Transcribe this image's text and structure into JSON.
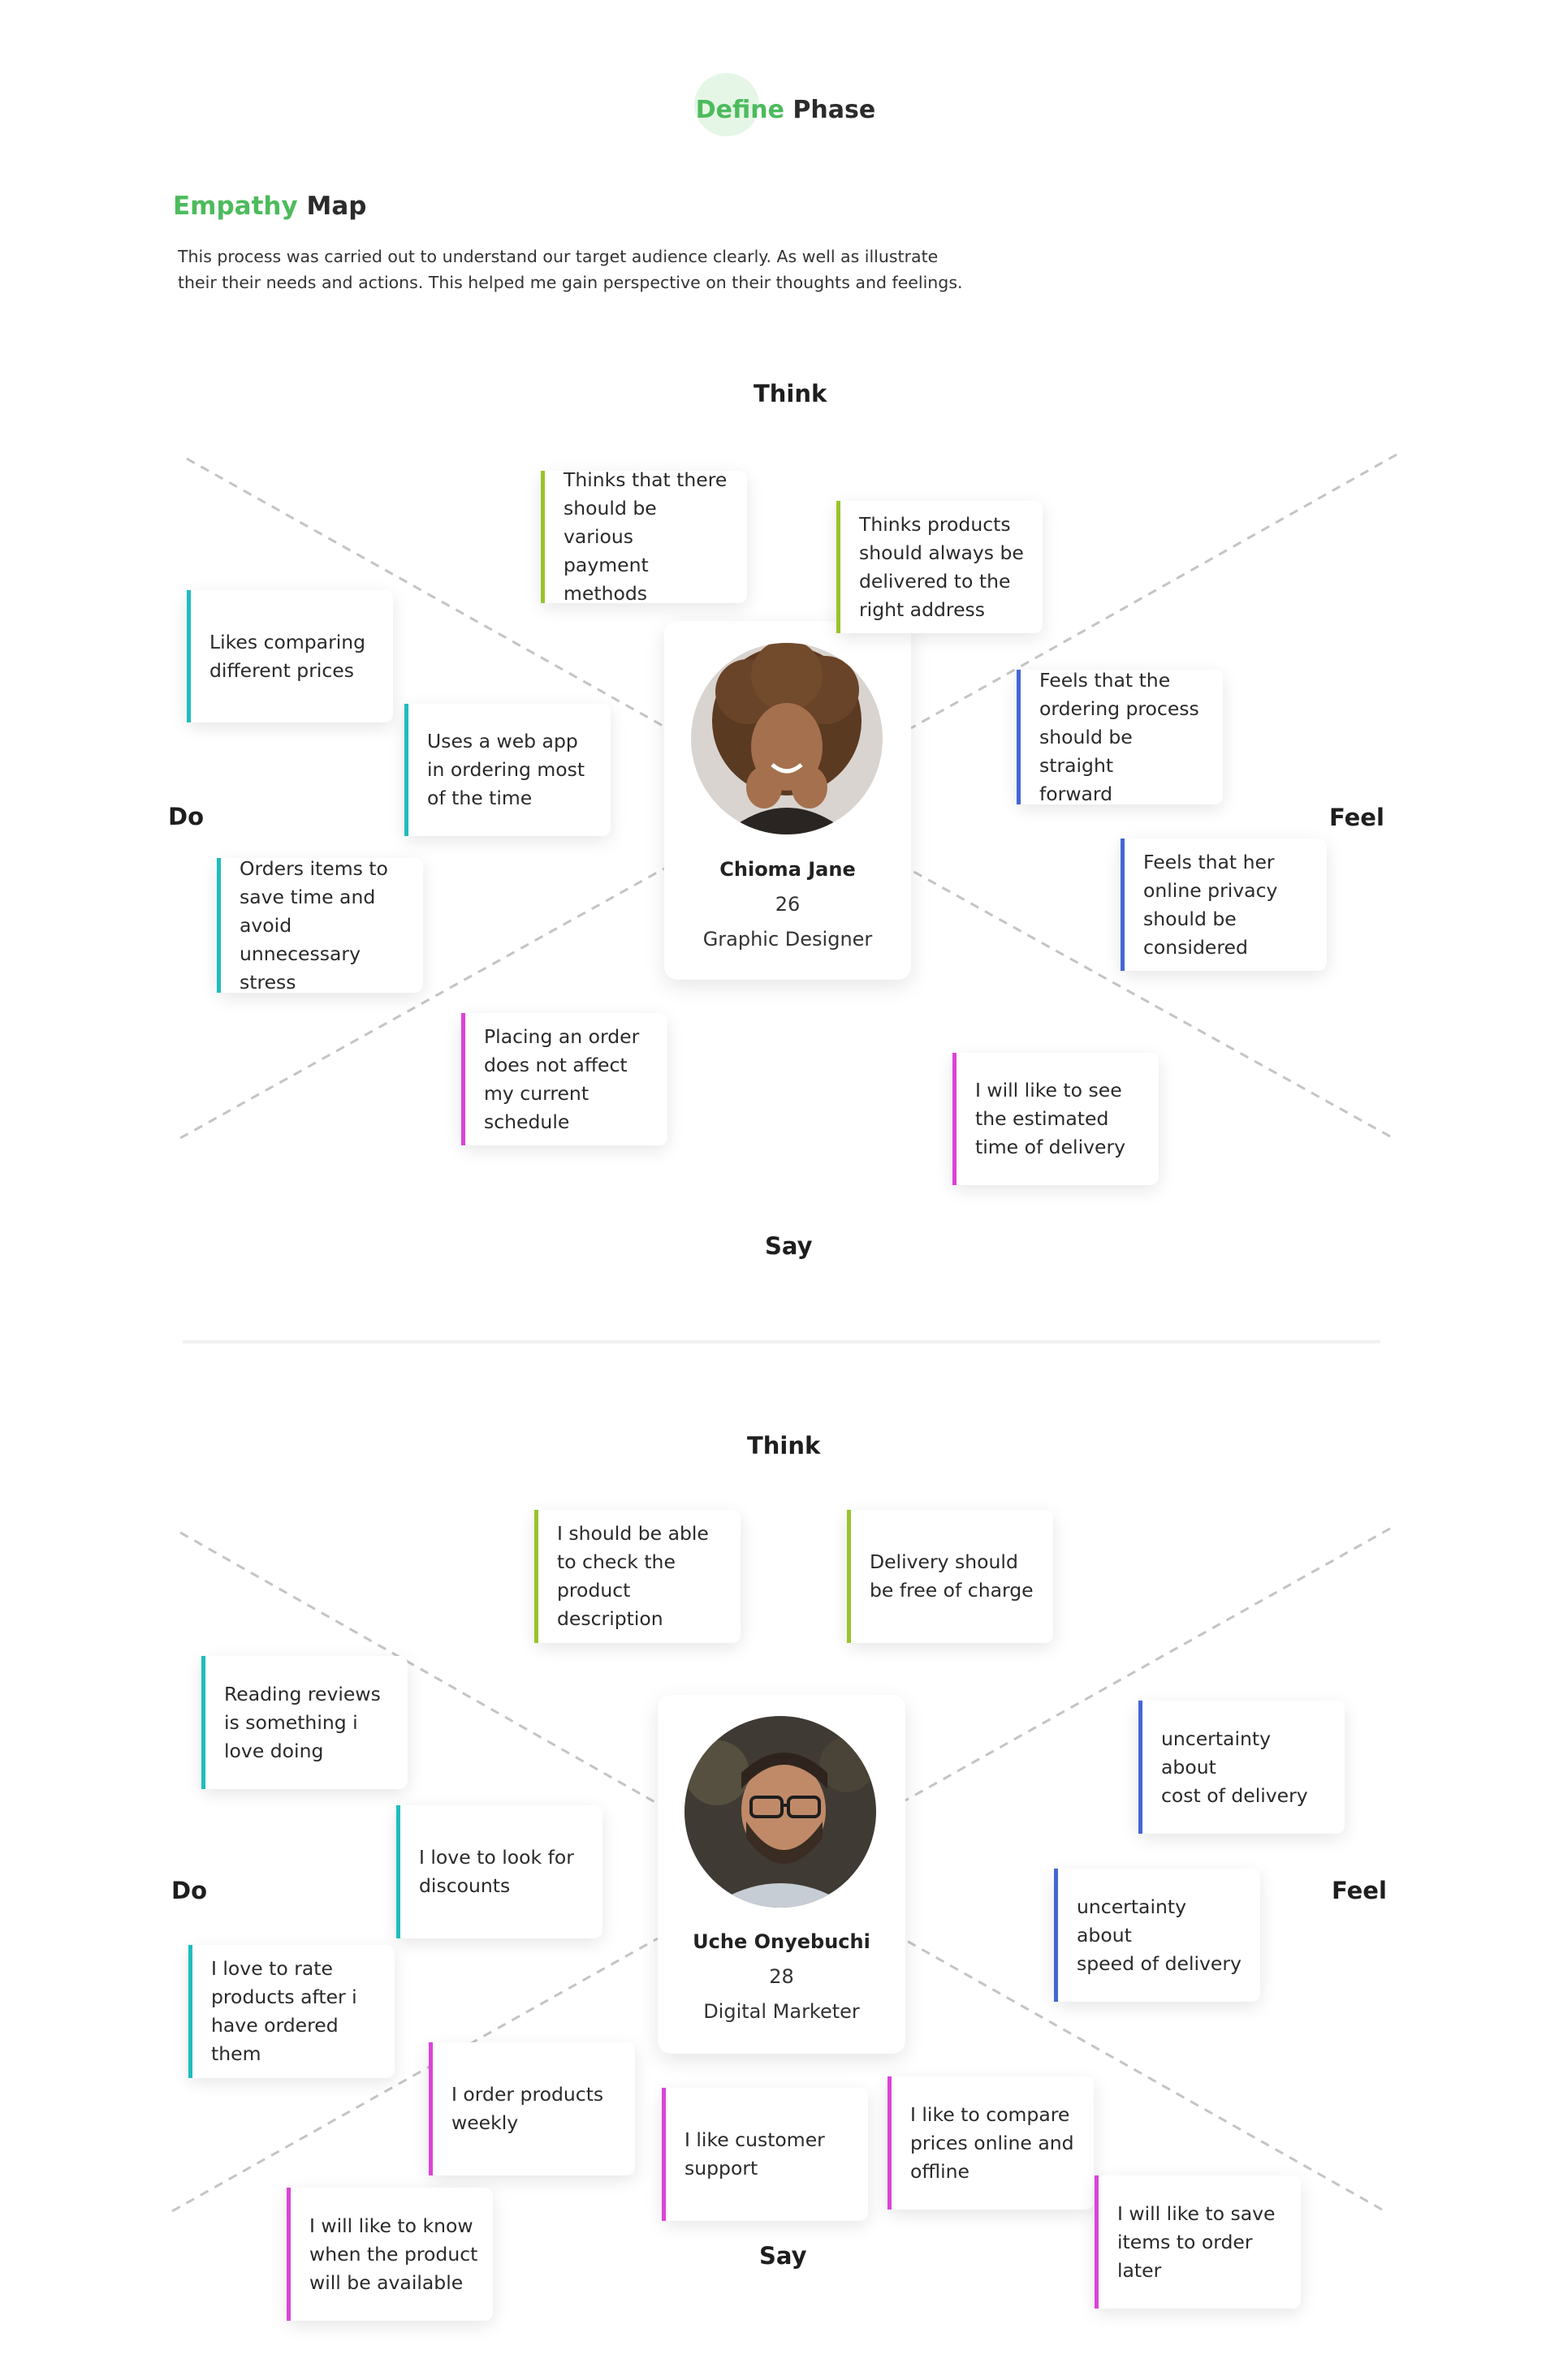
{
  "header": {
    "phase_word1": "Define",
    "phase_word2": "Phase",
    "section_word1": "Empathy",
    "section_word2": "Map",
    "intro_line1": "This process was carried out to understand our target audience clearly. As well as illustrate",
    "intro_line2": "their their needs and actions. This helped me gain perspective on their thoughts and feelings."
  },
  "colors": {
    "brand_green": "#4cbb5c",
    "think_bar": "#98c42b",
    "feel_bar": "#4466d4",
    "do_bar": "#1ebdbd",
    "say_bar": "#dc43d8"
  },
  "maps": [
    {
      "quadrants": {
        "think": "Think",
        "feel": "Feel",
        "do": "Do",
        "say": "Say"
      },
      "persona": {
        "name": "Chioma Jane",
        "age": "26",
        "role": "Graphic Designer",
        "avatar_icon": "woman-curly-hair-avatar-icon"
      },
      "cards": [
        {
          "category": "think",
          "text": "Thinks that there\nshould be various\npayment methods"
        },
        {
          "category": "think",
          "text": "Thinks products\nshould always be\ndelivered to the\nright address"
        },
        {
          "category": "do",
          "text": "Likes comparing\ndifferent prices"
        },
        {
          "category": "do",
          "text": "Uses a web app\nin ordering most\nof the time"
        },
        {
          "category": "do",
          "text": "Orders items to\nsave time and\navoid\nunnecessary\nstress"
        },
        {
          "category": "feel",
          "text": "Feels that the\nordering process\nshould be straight\nforward"
        },
        {
          "category": "feel",
          "text": "Feels that her\nonline privacy\nshould be\nconsidered"
        },
        {
          "category": "say",
          "text": "Placing an order\ndoes not affect\nmy current\nschedule"
        },
        {
          "category": "say",
          "text": "I will like to see\nthe estimated\ntime of delivery"
        }
      ]
    },
    {
      "quadrants": {
        "think": "Think",
        "feel": "Feel",
        "do": "Do",
        "say": "Say"
      },
      "persona": {
        "name": "Uche Onyebuchi",
        "age": "28",
        "role": "Digital Marketer",
        "avatar_icon": "bearded-man-glasses-avatar-icon"
      },
      "cards": [
        {
          "category": "think",
          "text": "I should be able\nto check the\nproduct\ndescription"
        },
        {
          "category": "think",
          "text": "Delivery should\nbe free of charge"
        },
        {
          "category": "do",
          "text": "Reading reviews\nis something i\nlove doing"
        },
        {
          "category": "do",
          "text": "I love to look for\ndiscounts"
        },
        {
          "category": "do",
          "text": "I love to rate\nproducts after i\nhave ordered\nthem"
        },
        {
          "category": "feel",
          "text": "uncertainty about\ncost of delivery"
        },
        {
          "category": "feel",
          "text": "uncertainty about\nspeed of delivery"
        },
        {
          "category": "say",
          "text": "I order products\nweekly"
        },
        {
          "category": "say",
          "text": "I like customer\nsupport"
        },
        {
          "category": "say",
          "text": "I like to compare\nprices online and\noffline"
        },
        {
          "category": "say",
          "text": "I will like to save\nitems to order\nlater"
        },
        {
          "category": "say",
          "text": "I will like to know\nwhen the product\nwill be available"
        }
      ]
    }
  ]
}
